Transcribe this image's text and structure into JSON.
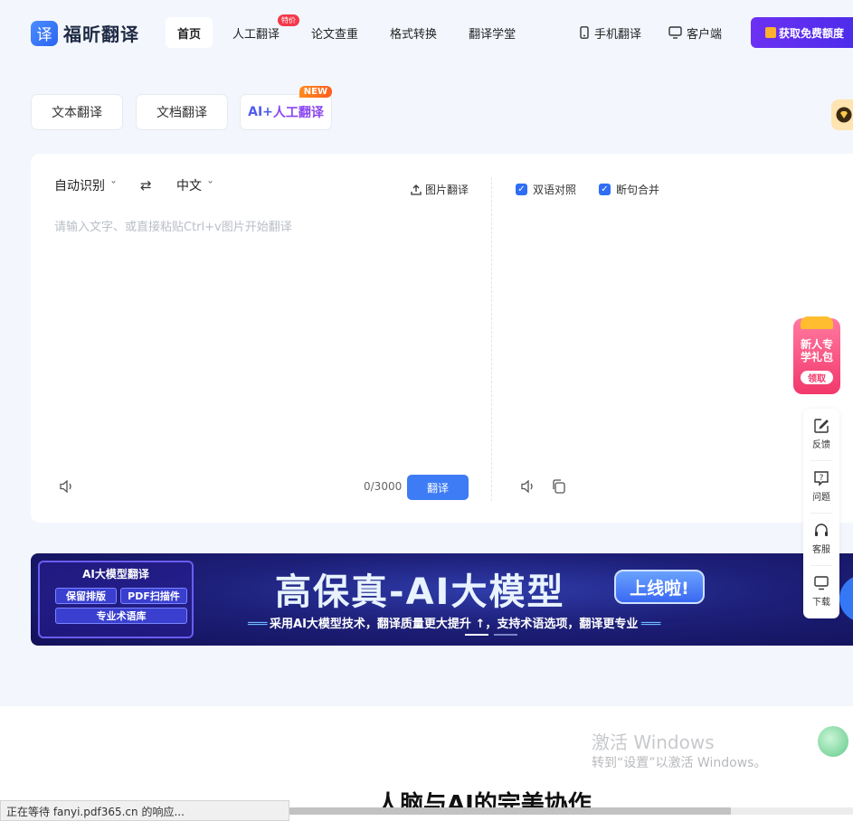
{
  "header": {
    "logo_glyph": "译",
    "logo_text": "福昕翻译",
    "nav": [
      {
        "label": "首页",
        "active": true
      },
      {
        "label": "人工翻译",
        "badge": "特价"
      },
      {
        "label": "论文查重"
      },
      {
        "label": "格式转换"
      },
      {
        "label": "翻译学堂"
      }
    ],
    "mobile_label": "手机翻译",
    "client_label": "客户端",
    "cta_label": "获取免费额度"
  },
  "modes": {
    "text": "文本翻译",
    "doc": "文档翻译",
    "ai_prefix": "AI+",
    "ai_suffix": "人工翻译",
    "new_badge": "NEW"
  },
  "translator": {
    "source_lang": "自动识别",
    "target_lang": "中文",
    "swap_icon": "⇄",
    "image_translate": "图片翻译",
    "placeholder": "请输入文字、或直接粘贴Ctrl+v图片开始翻译",
    "count": "0/3000",
    "translate_button": "翻译",
    "bilingual": "双语对照",
    "merge_sentences": "断句合并"
  },
  "banner": {
    "left_title": "AI大模型翻译",
    "chip_1": "保留排版",
    "chip_2": "PDF扫描件",
    "chip_3": "专业术语库",
    "title": "高保真-AI大模型",
    "pill": "上线啦!",
    "subtitle": "采用AI大模型技术，翻译质量更大提升 ↑，支持术语选项，翻译更专业",
    "active_slide": 1,
    "slides": 2
  },
  "gift": {
    "line1": "新人专",
    "line2": "学礼包",
    "button": "领取"
  },
  "side_panel": [
    {
      "label": "反馈",
      "icon": "edit-icon"
    },
    {
      "label": "问题",
      "icon": "question-icon"
    },
    {
      "label": "客服",
      "icon": "headset-icon"
    },
    {
      "label": "下载",
      "icon": "monitor-icon"
    }
  ],
  "lower": {
    "section_title": "人脑与AI的完美协作",
    "watermark_title": "激活 Windows",
    "watermark_sub": "转到“设置”以激活 Windows。"
  },
  "status_bar": "正在等待 fanyi.pdf365.cn 的响应..."
}
